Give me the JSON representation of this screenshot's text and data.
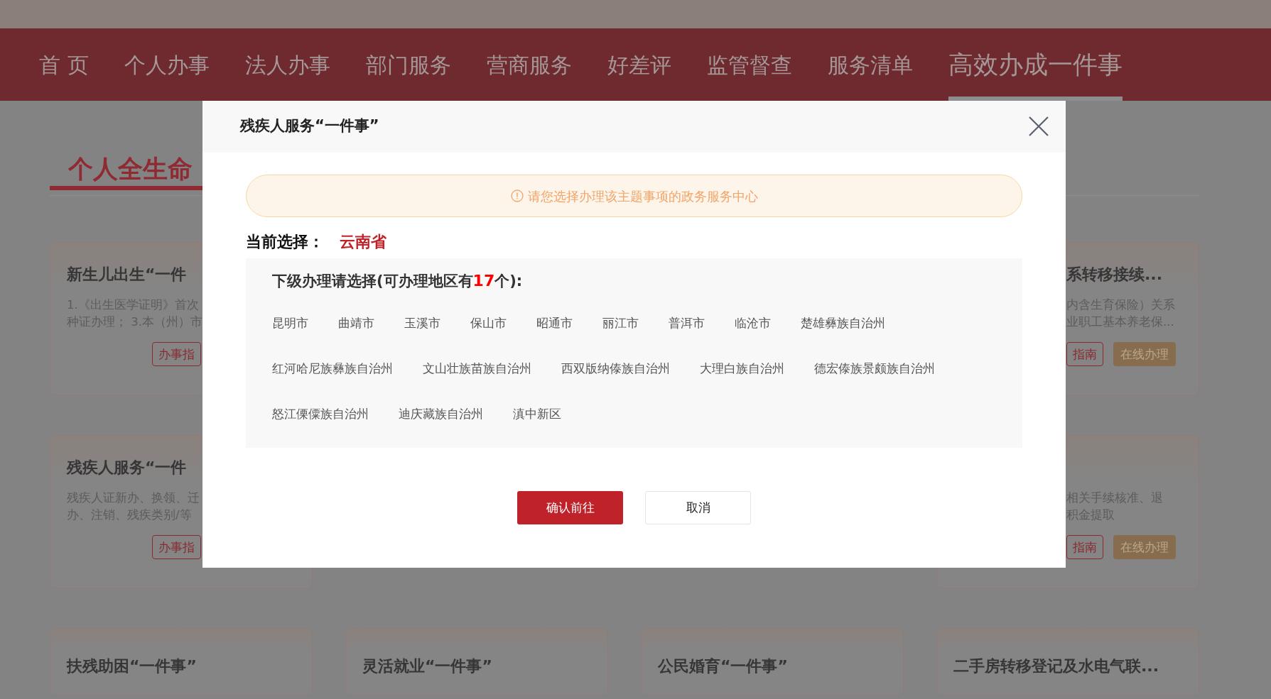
{
  "top_nav": [
    {
      "label": "首 页",
      "selected": false
    },
    {
      "label": "个人办事",
      "selected": false
    },
    {
      "label": "法人办事",
      "selected": false
    },
    {
      "label": "部门服务",
      "selected": false
    },
    {
      "label": "营商服务",
      "selected": false
    },
    {
      "label": "好差评",
      "selected": false
    },
    {
      "label": "监管督查",
      "selected": false
    },
    {
      "label": "服务清单",
      "selected": false
    },
    {
      "label": "高效办成一件事",
      "selected": true
    }
  ],
  "section_title": "个人全生命",
  "left_cards": [
    {
      "title": "新生儿出生“一件",
      "lines": [
        "1.《出生医学证明》首次",
        "种证办理； 3.本（州）市"
      ],
      "guide_button": "办事指"
    },
    {
      "title": "残疾人服务“一件",
      "lines": [
        "残疾人证新办、换领、迁",
        "办、注销、残疾类别/等"
      ],
      "guide_button": "办事指"
    }
  ],
  "right_cards": [
    {
      "title": "系转移接续...",
      "lines": [
        "内含生育保险）关系",
        "业职工基本养老保..."
      ],
      "guide_button": "指南",
      "online_button": "在线办理"
    },
    {
      "lines": [
        "相关手续核准、退",
        "积金提取"
      ],
      "guide_button": "指南",
      "online_button": "在线办理"
    }
  ],
  "bottom_cards": [
    {
      "title": "扶残助困“一件事”"
    },
    {
      "title": "灵活就业“一件事”"
    },
    {
      "title": "公民婚育“一件事”"
    },
    {
      "title": "二手房转移登记及水电气联..."
    }
  ],
  "dialog": {
    "title": "残疾人服务“一件事”",
    "notice": "请您选择办理该主题事项的政务服务中心",
    "current_label": "当前选择：",
    "current_value": "云南省",
    "regions_heading": {
      "prefix": "下级办理请选择(可办理地区有",
      "count": "17",
      "suffix": "个):"
    },
    "regions": [
      {
        "name": "昆明市",
        "selected": false
      },
      {
        "name": "曲靖市",
        "selected": false
      },
      {
        "name": "玉溪市",
        "selected": false
      },
      {
        "name": "保山市",
        "selected": false
      },
      {
        "name": "昭通市",
        "selected": false
      },
      {
        "name": "丽江市",
        "selected": false
      },
      {
        "name": "普洱市",
        "selected": false
      },
      {
        "name": "临沧市",
        "selected": false
      },
      {
        "name": "楚雄彝族自治州",
        "selected": false
      },
      {
        "name": "红河哈尼族彝族自治州",
        "selected": false
      },
      {
        "name": "文山壮族苗族自治州",
        "selected": false
      },
      {
        "name": "西双版纳傣族自治州",
        "selected": false
      },
      {
        "name": "大理白族自治州",
        "selected": false
      },
      {
        "name": "德宏傣族景颇族自治州",
        "selected": false
      },
      {
        "name": "怒江傈僳族自治州",
        "selected": false
      },
      {
        "name": "迪庆藏族自治州",
        "selected": false
      },
      {
        "name": "滇中新区",
        "selected": false
      }
    ],
    "confirm_button": "确认前往",
    "cancel_button": "取消"
  }
}
